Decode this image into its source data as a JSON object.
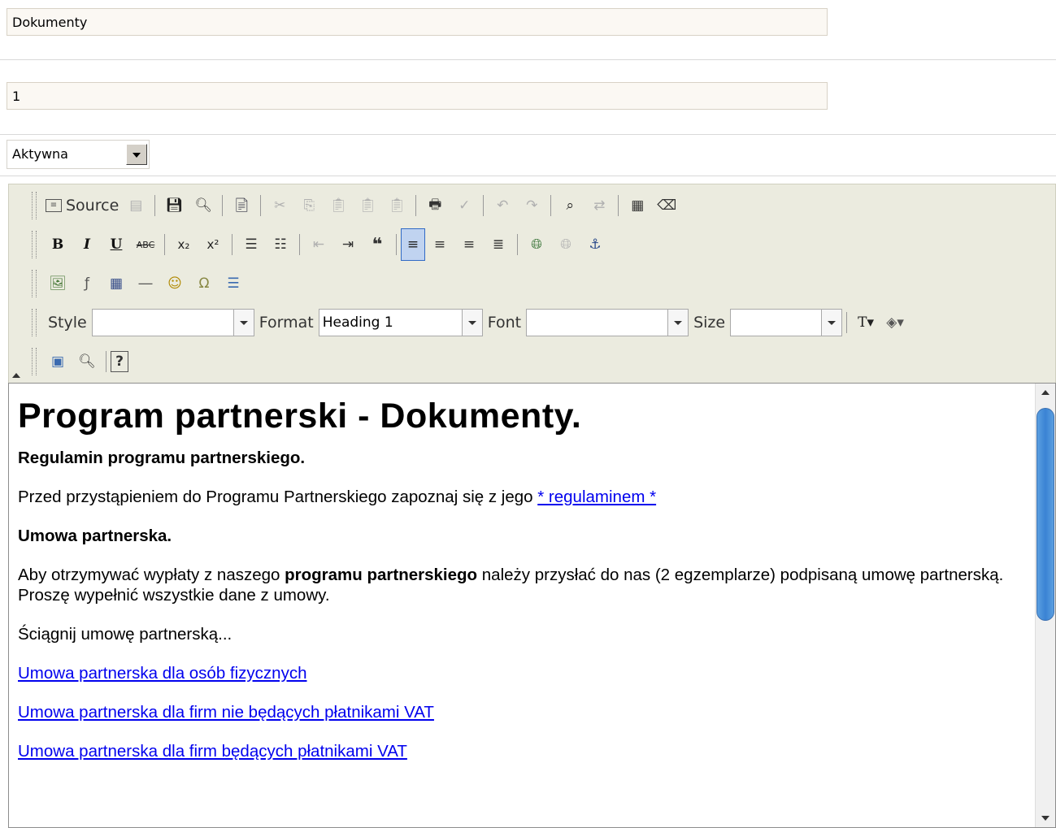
{
  "form": {
    "title_value": "Dokumenty",
    "order_value": "1",
    "status_value": "Aktywna"
  },
  "toolbar": {
    "source_label": "Source",
    "style_label": "Style",
    "style_value": "",
    "format_label": "Format",
    "format_value": "Heading 1",
    "font_label": "Font",
    "font_value": "",
    "size_label": "Size",
    "size_value": ""
  },
  "document": {
    "heading": "Program partnerski - Dokumenty.",
    "rules_heading": "Regulamin programu partnerskiego.",
    "rules_text": "Przed przystąpieniem do Programu Partnerskiego zapoznaj się z jego ",
    "rules_link": "* regulaminem *",
    "contract_heading": "Umowa partnerska.",
    "contract_text_1": "Aby otrzymywać wypłaty z naszego ",
    "contract_text_bold": "programu partnerskiego",
    "contract_text_2": " należy przysłać do nas (2 egzemplarze) podpisaną umowę partnerską. Proszę wypełnić wszystkie dane z umowy.",
    "download_text": "Ściągnij umowę partnerską...",
    "links": [
      "Umowa partnerska dla osób fizycznych",
      "Umowa partnerska dla firm nie będących płatnikami VAT",
      "Umowa partnerska dla firm będących płatnikami VAT"
    ]
  }
}
